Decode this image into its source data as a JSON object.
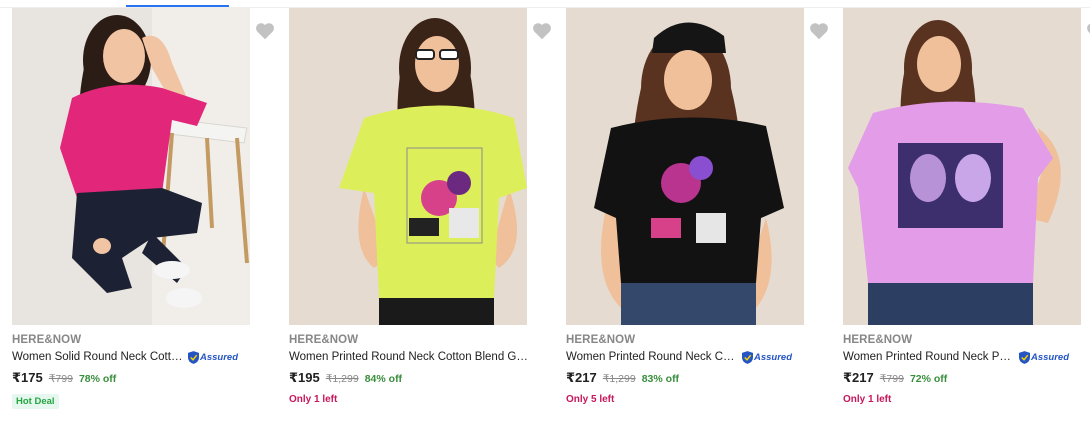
{
  "products": [
    {
      "brand": "HERE&NOW",
      "title": "Women Solid Round Neck Cotton Top",
      "assured": true,
      "assured_label": "Assured",
      "price": "₹175",
      "mrp": "₹799",
      "discount": "78% off",
      "tag": "Hot Deal",
      "stock": "",
      "shirt_color": "#e2267a",
      "bg_color": "#e8e4df",
      "wishlist_icon": "heart-icon"
    },
    {
      "brand": "HERE&NOW",
      "title": "Women Printed Round Neck Cotton Blend Graphic T-shirt",
      "assured": false,
      "assured_label": "",
      "price": "₹195",
      "mrp": "₹1,299",
      "discount": "84% off",
      "tag": "",
      "stock": "Only 1 left",
      "shirt_color": "#dcef5a",
      "bg_color": "#e6dbd1",
      "wishlist_icon": "heart-icon"
    },
    {
      "brand": "HERE&NOW",
      "title": "Women Printed Round Neck Cotton T-shirt",
      "assured": true,
      "assured_label": "Assured",
      "price": "₹217",
      "mrp": "₹1,299",
      "discount": "83% off",
      "tag": "",
      "stock": "Only 5 left",
      "shirt_color": "#121212",
      "bg_color": "#e6dbd1",
      "wishlist_icon": "heart-icon"
    },
    {
      "brand": "HERE&NOW",
      "title": "Women Printed Round Neck Pure Cotton T-shirt",
      "assured": true,
      "assured_label": "Assured",
      "price": "₹217",
      "mrp": "₹799",
      "discount": "72% off",
      "tag": "",
      "stock": "Only 1 left",
      "shirt_color": "#e29ce8",
      "bg_color": "#e6dbd1",
      "wishlist_icon": "heart-icon"
    }
  ]
}
